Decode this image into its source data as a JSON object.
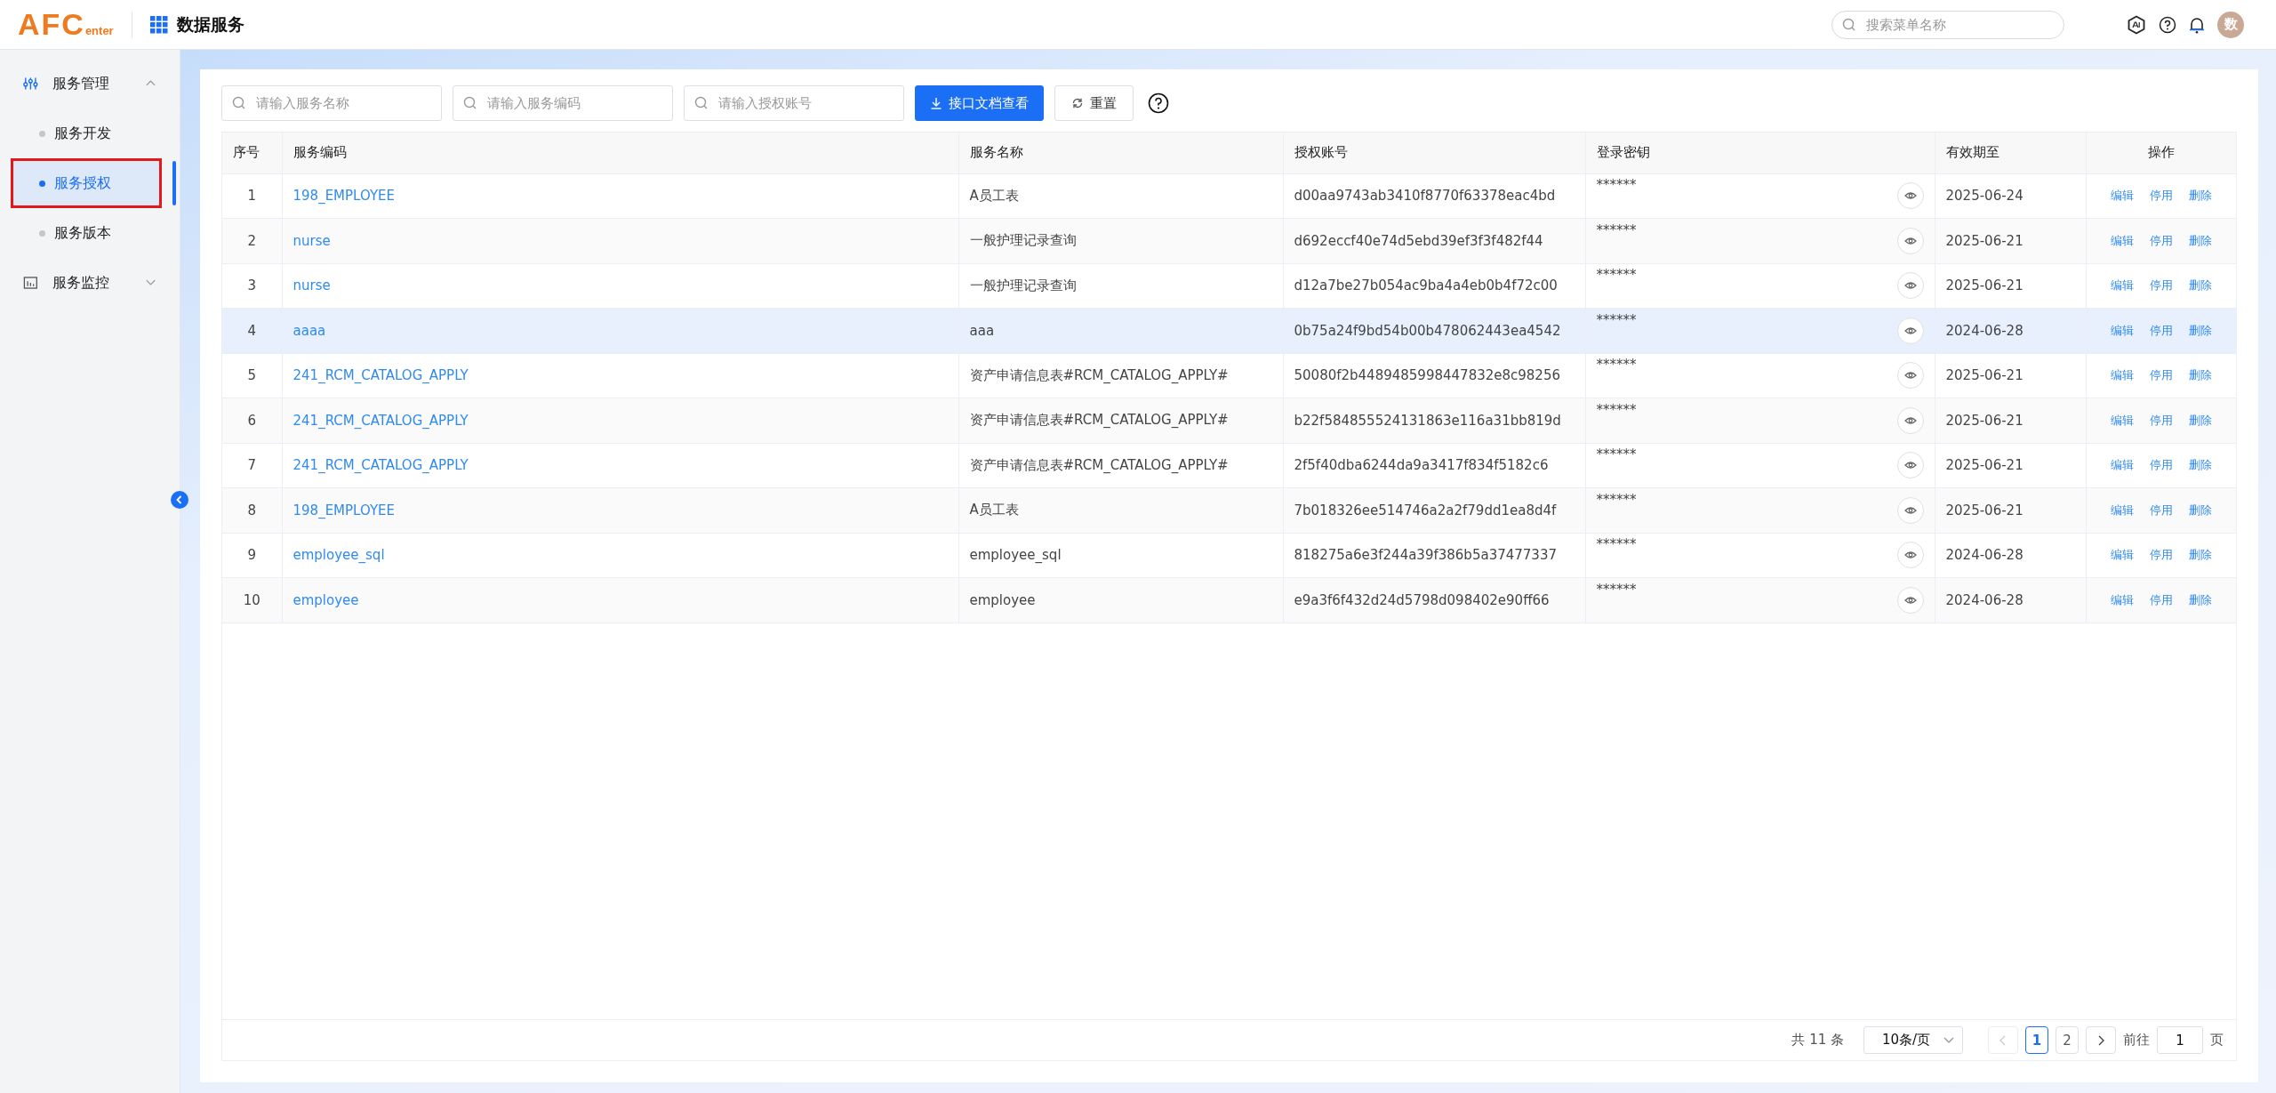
{
  "header": {
    "logo": {
      "main": "AFC",
      "sub": "enter"
    },
    "app_title": "数据服务",
    "search": {
      "placeholder": "搜索菜单名称"
    },
    "avatar": "数"
  },
  "sidebar": {
    "groups": [
      {
        "label": "服务管理",
        "expanded": true,
        "children": [
          {
            "label": "服务开发",
            "selected": false
          },
          {
            "label": "服务授权",
            "selected": true
          },
          {
            "label": "服务版本",
            "selected": false
          }
        ]
      },
      {
        "label": "服务监控",
        "expanded": false
      }
    ]
  },
  "toolbar": {
    "filters": [
      {
        "placeholder": "请输入服务名称"
      },
      {
        "placeholder": "请输入服务编码"
      },
      {
        "placeholder": "请输入授权账号"
      }
    ],
    "buttons": [
      {
        "kind": "primary",
        "label": "接口文档查看"
      },
      {
        "kind": "reset",
        "label": "重置"
      }
    ]
  },
  "table": {
    "columns": [
      "序号",
      "服务编码",
      "服务名称",
      "授权账号",
      "登录密钥",
      "有效期至",
      "操作"
    ],
    "rows": [
      {
        "index": "1",
        "code": "198_EMPLOYEE",
        "name": "A员工表",
        "account": "d00aa9743ab3410f8770f63378eac4bd",
        "secret": "******",
        "expiry": "2025-06-24",
        "actions": [
          "编辑",
          "停用",
          "删除"
        ],
        "highlighted": false
      },
      {
        "index": "2",
        "code": "nurse",
        "name": "一般护理记录查询",
        "account": "d692eccf40e74d5ebd39ef3f3f482f44",
        "secret": "******",
        "expiry": "2025-06-21",
        "actions": [
          "编辑",
          "停用",
          "删除"
        ],
        "highlighted": false
      },
      {
        "index": "3",
        "code": "nurse",
        "name": "一般护理记录查询",
        "account": "d12a7be27b054ac9ba4a4eb0b4f72c00",
        "secret": "******",
        "expiry": "2025-06-21",
        "actions": [
          "编辑",
          "停用",
          "删除"
        ],
        "highlighted": false
      },
      {
        "index": "4",
        "code": "aaaa",
        "name": "aaa",
        "account": "0b75a24f9bd54b00b478062443ea4542",
        "secret": "******",
        "expiry": "2024-06-28",
        "actions": [
          "编辑",
          "停用",
          "删除"
        ],
        "highlighted": true
      },
      {
        "index": "5",
        "code": "241_RCM_CATALOG_APPLY",
        "name": "资产申请信息表#RCM_CATALOG_APPLY#",
        "account": "50080f2b4489485998447832e8c98256",
        "secret": "******",
        "expiry": "2025-06-21",
        "actions": [
          "编辑",
          "停用",
          "删除"
        ],
        "highlighted": false
      },
      {
        "index": "6",
        "code": "241_RCM_CATALOG_APPLY",
        "name": "资产申请信息表#RCM_CATALOG_APPLY#",
        "account": "b22f584855524131863e116a31bb819d",
        "secret": "******",
        "expiry": "2025-06-21",
        "actions": [
          "编辑",
          "停用",
          "删除"
        ],
        "highlighted": false
      },
      {
        "index": "7",
        "code": "241_RCM_CATALOG_APPLY",
        "name": "资产申请信息表#RCM_CATALOG_APPLY#",
        "account": "2f5f40dba6244da9a3417f834f5182c6",
        "secret": "******",
        "expiry": "2025-06-21",
        "actions": [
          "编辑",
          "停用",
          "删除"
        ],
        "highlighted": false
      },
      {
        "index": "8",
        "code": "198_EMPLOYEE",
        "name": "A员工表",
        "account": "7b018326ee514746a2a2f79dd1ea8d4f",
        "secret": "******",
        "expiry": "2025-06-21",
        "actions": [
          "编辑",
          "停用",
          "删除"
        ],
        "highlighted": false
      },
      {
        "index": "9",
        "code": "employee_sql",
        "name": "employee_sql",
        "account": "818275a6e3f244a39f386b5a37477337",
        "secret": "******",
        "expiry": "2024-06-28",
        "actions": [
          "编辑",
          "停用",
          "删除"
        ],
        "highlighted": false
      },
      {
        "index": "10",
        "code": "employee",
        "name": "employee",
        "account": "e9a3f6f432d24d5798d098402e90ff66",
        "secret": "******",
        "expiry": "2024-06-28",
        "actions": [
          "编辑",
          "停用",
          "删除"
        ],
        "highlighted": false
      }
    ]
  },
  "pagination": {
    "total": "共 11 条",
    "page_size": "10条/页",
    "pages": [
      {
        "label": "1",
        "selected": true
      },
      {
        "label": "2",
        "selected": false
      }
    ],
    "goto_label": "前往",
    "goto_value": "1",
    "page_unit": "页"
  }
}
